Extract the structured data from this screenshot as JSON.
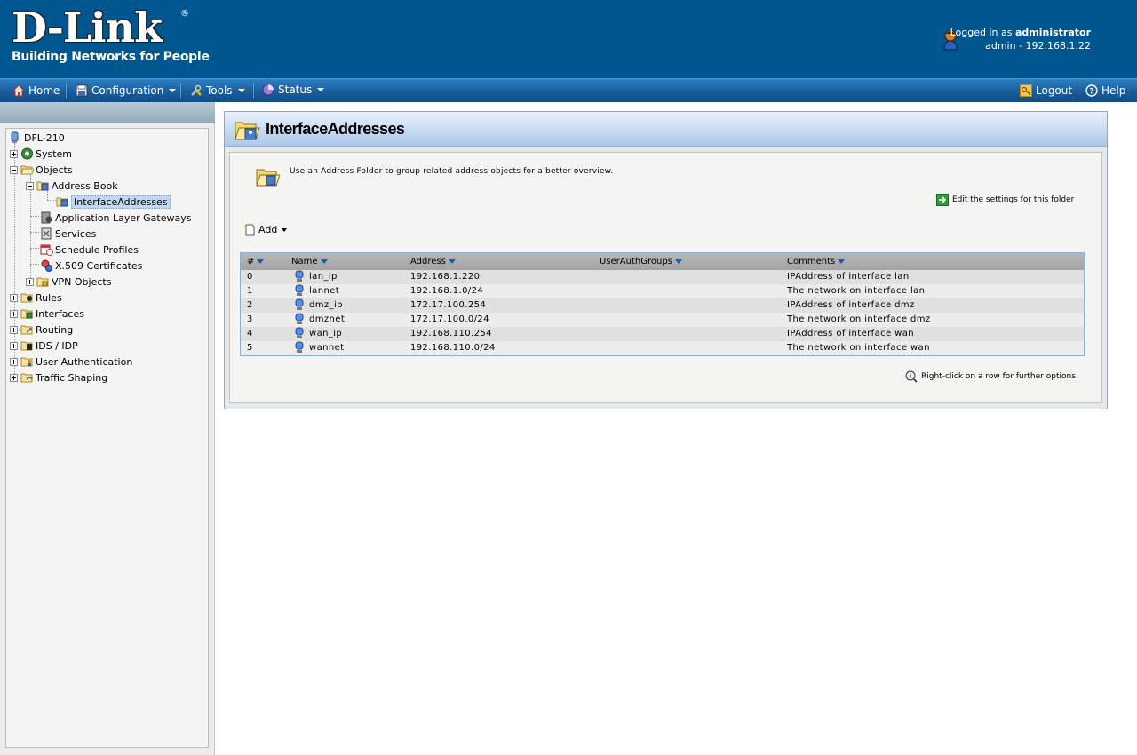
{
  "header": {
    "logo_main": "D-Link",
    "logo_reg": "®",
    "logo_tagline": "Building Networks for People",
    "login_prefix": "Logged in as",
    "login_user": "administrator",
    "login_detail": "admin - 192.168.1.22"
  },
  "menu": {
    "home": "Home",
    "configuration": "Configuration",
    "tools": "Tools",
    "status": "Status",
    "logout": "Logout",
    "help": "Help"
  },
  "tree": {
    "root": "DFL-210",
    "system": "System",
    "objects": "Objects",
    "address_book": "Address Book",
    "interface_addresses": "InterfaceAddresses",
    "alg": "Application Layer Gateways",
    "services": "Services",
    "schedule_profiles": "Schedule Profiles",
    "x509": "X.509 Certificates",
    "vpn_objects": "VPN Objects",
    "rules": "Rules",
    "interfaces": "Interfaces",
    "routing": "Routing",
    "ids_idp": "IDS / IDP",
    "user_auth": "User Authentication",
    "traffic_shaping": "Traffic Shaping"
  },
  "page": {
    "title": "InterfaceAddresses",
    "description": "Use an Address Folder to group related address objects for a better overview.",
    "edit_link": "Edit the settings for this folder",
    "add_label": "Add",
    "hint": "Right-click on a row for further options."
  },
  "table": {
    "headers": {
      "num": "#",
      "name": "Name",
      "address": "Address",
      "groups": "UserAuthGroups",
      "comments": "Comments"
    },
    "rows": [
      {
        "num": "0",
        "name": "lan_ip",
        "address": "192.168.1.220",
        "groups": "",
        "comments": "IPAddress of interface lan"
      },
      {
        "num": "1",
        "name": "lannet",
        "address": "192.168.1.0/24",
        "groups": "",
        "comments": "The network on interface lan"
      },
      {
        "num": "2",
        "name": "dmz_ip",
        "address": "172.17.100.254",
        "groups": "",
        "comments": "IPAddress of interface dmz"
      },
      {
        "num": "3",
        "name": "dmznet",
        "address": "172.17.100.0/24",
        "groups": "",
        "comments": "The network on interface dmz"
      },
      {
        "num": "4",
        "name": "wan_ip",
        "address": "192.168.110.254",
        "groups": "",
        "comments": "IPAddress of interface wan"
      },
      {
        "num": "5",
        "name": "wannet",
        "address": "192.168.110.0/24",
        "groups": "",
        "comments": "The network on interface wan"
      }
    ]
  },
  "colors": {
    "header_bg": "#00568f",
    "menubar": "#1a5d9b",
    "selected": "#c5d7ee"
  }
}
